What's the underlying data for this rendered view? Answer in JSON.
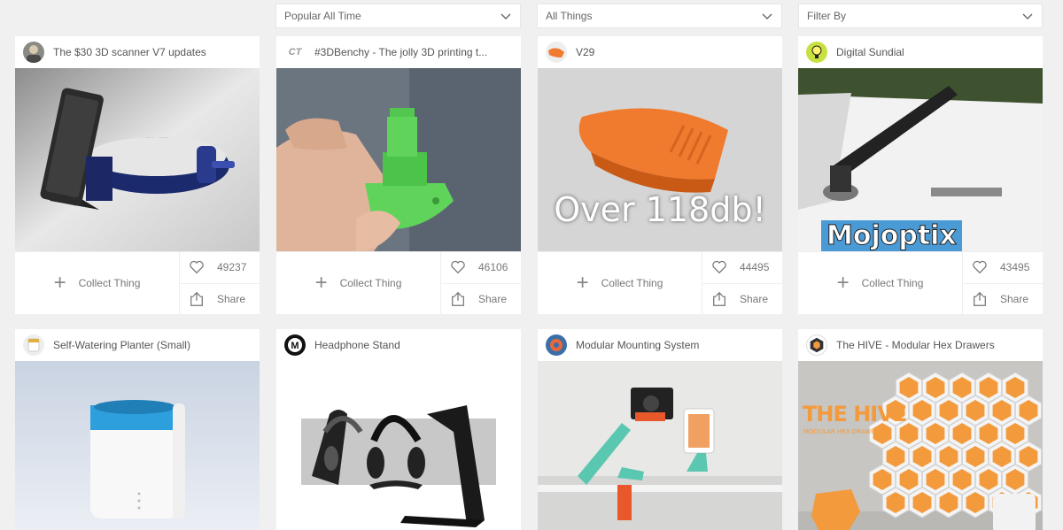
{
  "filters": {
    "sort": "Popular All Time",
    "type": "All Things",
    "filter": "Filter By"
  },
  "labels": {
    "collect": "Collect Thing",
    "share": "Share"
  },
  "cards": [
    {
      "title": "The $30 3D scanner V7 updates",
      "likes": "49237"
    },
    {
      "title": "#3DBenchy - The jolly 3D printing t...",
      "likes": "46106",
      "avatar_text": "CT"
    },
    {
      "title": "V29",
      "likes": "44495",
      "overlay": "Over 118db!"
    },
    {
      "title": "Digital Sundial",
      "likes": "43495",
      "overlay": "Mojoptix"
    },
    {
      "title": "Self-Watering Planter (Small)"
    },
    {
      "title": "Headphone Stand"
    },
    {
      "title": "Modular Mounting System"
    },
    {
      "title": "The HIVE - Modular Hex Drawers",
      "overlay": "THE HIVE",
      "overlay_sub": "MODULAR HEX DRAWERS"
    }
  ],
  "colors": {
    "benchy_green": "#5fd35a",
    "whistle_orange": "#f07a2e",
    "planter_blue": "#2d9fdc",
    "hive_orange": "#f39a3c"
  }
}
